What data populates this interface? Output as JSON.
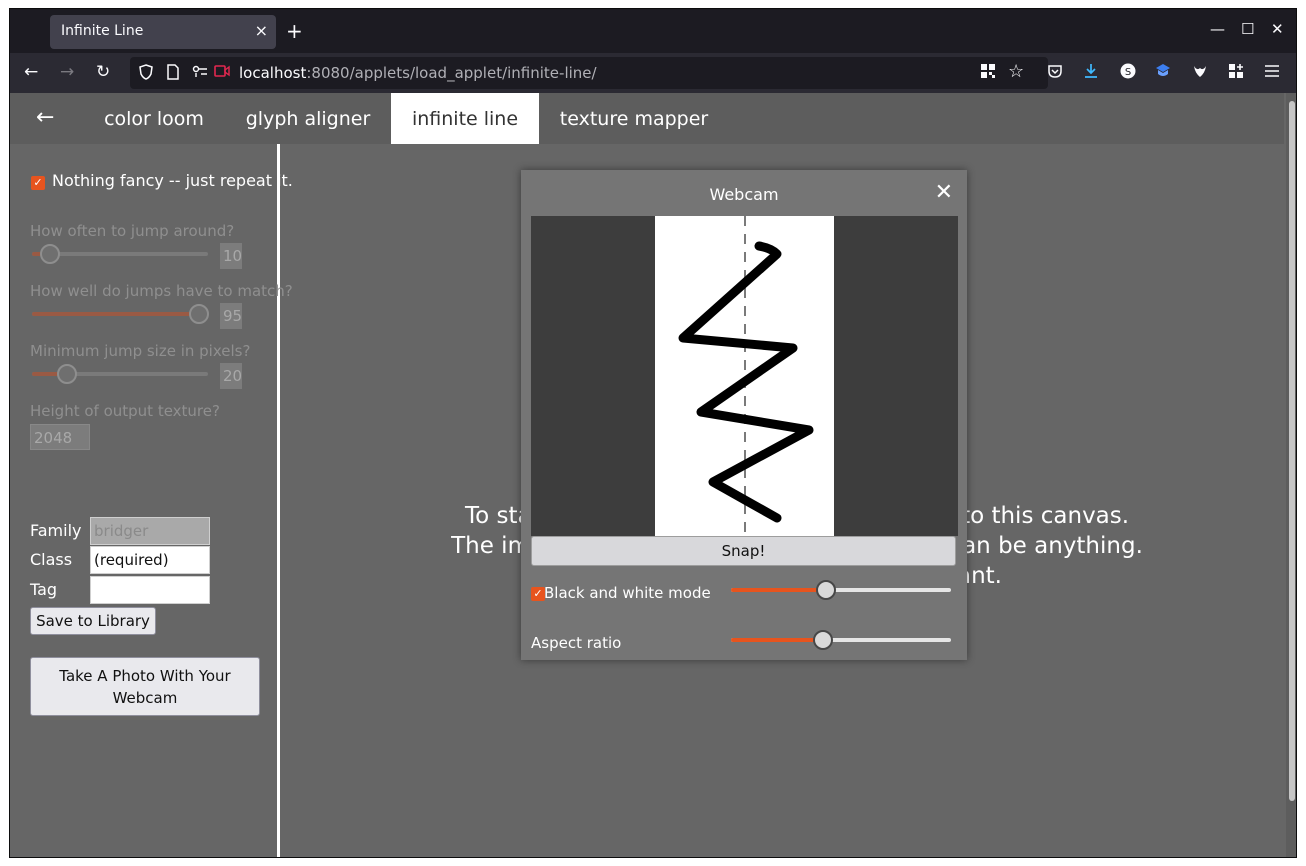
{
  "browser": {
    "tab_title": "Infinite Line",
    "tab_close": "×",
    "new_tab": "+",
    "url_host": "localhost",
    "url_path": ":8080/applets/load_applet/infinite-line/",
    "window_controls": {
      "minimize": "—",
      "maximize": "☐",
      "close": "✕"
    }
  },
  "nav": {
    "back": "←",
    "forward": "→",
    "reload": "↻"
  },
  "app_tabs": {
    "back": "←",
    "items": [
      {
        "label": "color loom",
        "active": false
      },
      {
        "label": "glyph aligner",
        "active": false
      },
      {
        "label": "infinite line",
        "active": true
      },
      {
        "label": "texture mapper",
        "active": false
      }
    ]
  },
  "sidebar": {
    "repeat_checkbox_label": "Nothing fancy -- just repeat it.",
    "repeat_checked": true,
    "jump_often_label": "How often to jump around?",
    "jump_often_value": "10",
    "jump_often_level": 0.1,
    "jump_match_label": "How well do jumps have to match?",
    "jump_match_value": "95",
    "jump_match_level": 0.95,
    "min_jump_label": "Minimum jump size in pixels?",
    "min_jump_value": "20",
    "min_jump_level": 0.2,
    "height_label": "Height of output texture?",
    "height_value": "2048",
    "family_label": "Family",
    "family_value": "bridger",
    "class_label": "Class",
    "class_value": "(required)",
    "tag_label": "Tag",
    "tag_value": "",
    "save_button": "Save to Library",
    "webcam_button": "Take A Photo With Your Webcam"
  },
  "canvas": {
    "line1": "To start, drag an image of a vertical line onto this canvas.",
    "line2": "The image width must be even, but height can be anything.",
    "line3": "The line can be rotated if you want."
  },
  "webcam_modal": {
    "title": "Webcam",
    "close": "✕",
    "snap_button": "Snap!",
    "bw_label": "Black and white mode",
    "bw_checked": true,
    "bw_level": 0.43,
    "aspect_label": "Aspect ratio",
    "aspect_level": 0.42
  },
  "colors": {
    "accent": "#e7541e",
    "page_bg": "#666666",
    "browser_bg": "#1c1b22"
  }
}
